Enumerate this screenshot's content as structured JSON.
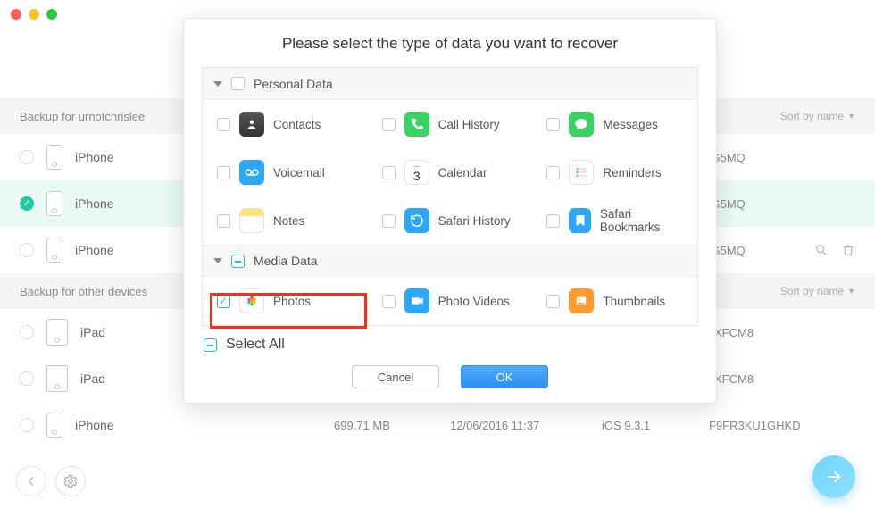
{
  "modal": {
    "title": "Please select the type of data you want to recover",
    "cat_personal": "Personal Data",
    "cat_media": "Media Data",
    "items": {
      "contacts": "Contacts",
      "callhistory": "Call History",
      "messages": "Messages",
      "voicemail": "Voicemail",
      "calendar": "Calendar",
      "reminders": "Reminders",
      "notes": "Notes",
      "safarihist": "Safari History",
      "safaribm": "Safari Bookmarks",
      "photos": "Photos",
      "photovideos": "Photo Videos",
      "thumbnails": "Thumbnails"
    },
    "calendar_day": "3",
    "select_all": "Select All",
    "cancel": "Cancel",
    "ok": "OK"
  },
  "bg": {
    "section1": "Backup for urnotchrislee",
    "section2": "Backup for other devices",
    "sort": "Sort by name",
    "rows": [
      {
        "name": "iPhone",
        "serial": "'G5MQ"
      },
      {
        "name": "iPhone",
        "serial": "'G5MQ"
      },
      {
        "name": "iPhone",
        "serial": "'G5MQ"
      },
      {
        "name": "iPad",
        "serial": "XFCM8"
      },
      {
        "name": "iPad",
        "serial": "XFCM8"
      },
      {
        "name": "iPhone",
        "size": "699.71 MB",
        "date": "12/06/2016 11:37",
        "os": "iOS 9.3.1",
        "serial": "F9FR3KU1GHKD"
      }
    ]
  }
}
